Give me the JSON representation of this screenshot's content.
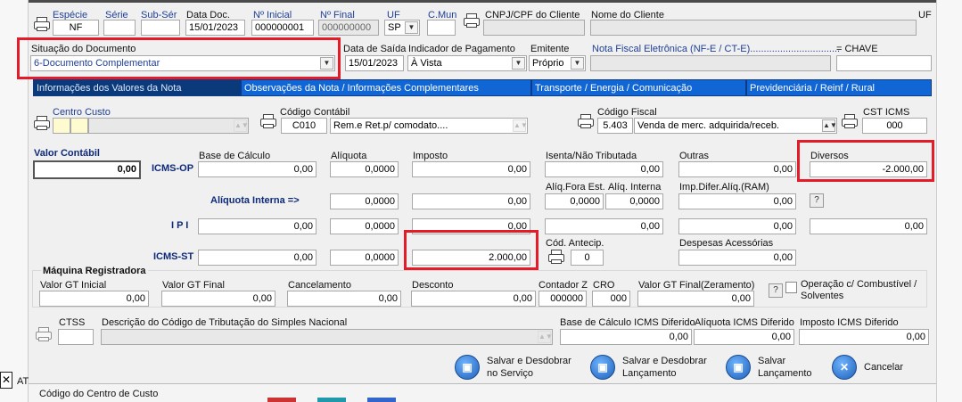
{
  "header": {
    "especie": {
      "label": "Espécie",
      "value": "NF"
    },
    "serie": {
      "label": "Série",
      "value": ""
    },
    "subserie": {
      "label": "Sub-Sér",
      "value": ""
    },
    "data_doc": {
      "label": "Data Doc.",
      "value": "15/01/2023"
    },
    "n_inicial": {
      "label": "Nº Inicial",
      "value": "000000001"
    },
    "n_final": {
      "label": "Nº Final",
      "value": "000000000"
    },
    "uf": {
      "label": "UF",
      "value": "SP"
    },
    "cmun": {
      "label": "C.Mun",
      "value": ""
    },
    "cnpj": {
      "label": "CNPJ/CPF do Cliente",
      "value": ""
    },
    "nome_cliente": {
      "label": "Nome do Cliente",
      "value": ""
    },
    "uf2": {
      "label": "UF"
    }
  },
  "row2": {
    "situacao": {
      "label": "Situação do Documento",
      "value": "6-Documento Complementar"
    },
    "data_saida": {
      "label": "Data de Saída",
      "value": "15/01/2023"
    },
    "ind_pagamento": {
      "label": "Indicador de Pagamento",
      "value": "À Vista"
    },
    "emitente": {
      "label": "Emitente",
      "value": "Próprio"
    },
    "nfe_label": "Nota Fiscal Eletrônica (NF-E / CT-E).................................",
    "chave_label": "=  CHAVE"
  },
  "tabs": [
    {
      "label": "Informações dos Valores da Nota"
    },
    {
      "label": "Observações da Nota / Informações Complementares"
    },
    {
      "label": "Transporte / Energia / Comunicação"
    },
    {
      "label": "Previdenciária / Reinf / Rural"
    }
  ],
  "row3": {
    "centro_custo": {
      "label": "Centro Custo"
    },
    "codigo_contabil": {
      "label": "Código Contábil",
      "code": "C010",
      "desc": "Rem.e Ret.p/ comodato...."
    },
    "codigo_fiscal": {
      "label": "Código Fiscal",
      "code": "5.403",
      "desc": "Venda de merc. adquirida/receb."
    },
    "cst_icms": {
      "label": "CST ICMS",
      "value": "000"
    }
  },
  "valor_contabil": {
    "label": "Valor Contábil",
    "value": "0,00"
  },
  "icms_op": {
    "label": "ICMS-OP",
    "base": {
      "label": "Base de Cálculo",
      "value": "0,00"
    },
    "aliquota": {
      "label": "Alíquota",
      "value": "0,0000"
    },
    "imposto": {
      "label": "Imposto",
      "value": "0,00"
    },
    "isenta": {
      "label": "Isenta/Não Tributada",
      "value": "0,00"
    },
    "outras": {
      "label": "Outras",
      "value": "0,00"
    },
    "diversos": {
      "label": "Diversos",
      "value": "-2.000,00"
    }
  },
  "aliquota_interna": {
    "label": "Alíquota Interna =>",
    "v1": "0,0000",
    "v2": "0,00",
    "fora_est": {
      "label": "Alíq.Fora Est.",
      "value": "0,0000"
    },
    "interna": {
      "label": "Alíq. Interna",
      "value": "0,0000"
    },
    "imp_difer": {
      "label": "Imp.Difer.Alíq.(RAM)",
      "value": "0,00"
    }
  },
  "ipi": {
    "label": "I P I",
    "v1": "0,00",
    "v2": "0,0000",
    "v3": "0,00",
    "v4": "0,00",
    "v5": "0,00",
    "v6": "0,00"
  },
  "icms_st": {
    "label": "ICMS-ST",
    "base": "0,00",
    "aliquota": "0,0000",
    "imposto": "2.000,00",
    "cod_antecip": {
      "label": "Cód. Antecip.",
      "value": "0"
    },
    "despesas": {
      "label": "Despesas Acessórias",
      "value": "0,00"
    }
  },
  "maquina": {
    "title": "Máquina Registradora",
    "gt_inicial": {
      "label": "Valor GT Inicial",
      "value": "0,00"
    },
    "gt_final": {
      "label": "Valor GT Final",
      "value": "0,00"
    },
    "cancelamento": {
      "label": "Cancelamento",
      "value": "0,00"
    },
    "desconto": {
      "label": "Desconto",
      "value": "0,00"
    },
    "contador_z": {
      "label": "Contador Z",
      "value": "000000"
    },
    "cro": {
      "label": "CRO",
      "value": "000"
    },
    "gt_final_zer": {
      "label": "Valor GT Final(Zeramento)",
      "value": "0,00"
    },
    "op_combustivel": "Operação c/ Combustível / Solventes"
  },
  "simples": {
    "ctss": {
      "label": "CTSS",
      "value": ""
    },
    "descricao": {
      "label": "Descrição do Código de Tributação do Simples Nacional",
      "value": ""
    },
    "base_dif": {
      "label": "Base de Cálculo ICMS Diferido",
      "value": "0,00"
    },
    "aliq_dif": {
      "label": "Alíquota ICMS Diferido",
      "value": "0,00"
    },
    "imp_dif": {
      "label": "Imposto ICMS Diferido",
      "value": "0,00"
    }
  },
  "actions": [
    {
      "label": "Salvar e Desdobrar no Serviço",
      "icon": "save-icon"
    },
    {
      "label": "Salvar e Desdobrar Lançamento",
      "icon": "save-icon"
    },
    {
      "label": "Salvar Lançamento",
      "icon": "save-icon"
    },
    {
      "label": "Cancelar",
      "icon": "close-icon"
    }
  ],
  "footer": {
    "codigo_centro_custo": "Código do Centro de Custo",
    "at": "AT"
  }
}
